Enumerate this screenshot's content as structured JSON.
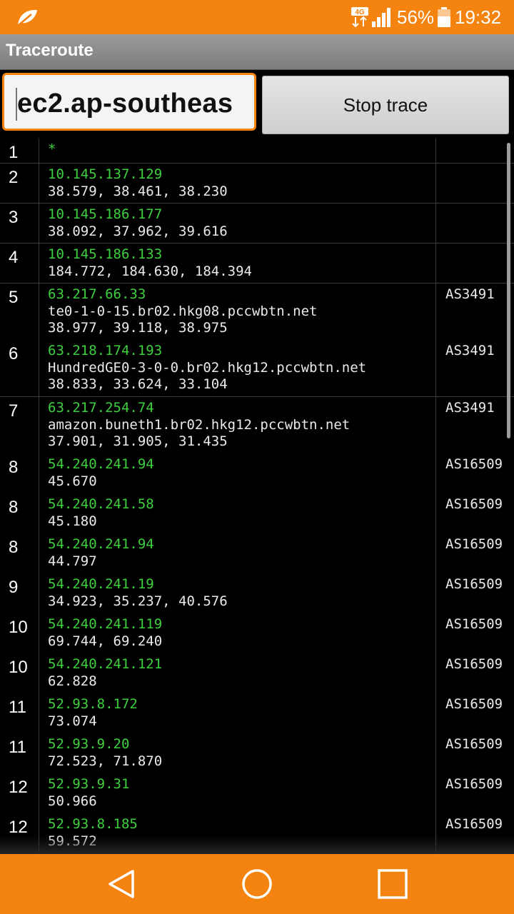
{
  "status_bar": {
    "network_type": "4G",
    "battery_percent": "56%",
    "time": "19:32",
    "icons": [
      "leaf-icon",
      "network-4g-icon",
      "signal-icon",
      "battery-icon"
    ]
  },
  "app": {
    "title": "Traceroute"
  },
  "controls": {
    "host_value": "ec2.ap-southeas",
    "stop_label": "Stop trace"
  },
  "hops": [
    {
      "n": "1",
      "lines": [
        "*"
      ],
      "as": "",
      "h": 34,
      "sep": false
    },
    {
      "n": "2",
      "lines": [
        "10.145.137.129",
        "38.579, 38.461, 38.230"
      ],
      "as": "",
      "h": 56,
      "sep": true
    },
    {
      "n": "3",
      "lines": [
        "10.145.186.177",
        "38.092, 37.962, 39.616"
      ],
      "as": "",
      "h": 56,
      "sep": true
    },
    {
      "n": "4",
      "lines": [
        "10.145.186.133",
        "184.772, 184.630, 184.394"
      ],
      "as": "",
      "h": 56,
      "sep": true
    },
    {
      "n": "5",
      "lines": [
        "63.217.66.33",
        "te0-1-0-15.br02.hkg08.pccwbtn.net",
        "38.977, 39.118, 38.975"
      ],
      "as": "AS3491",
      "h": 80,
      "sep": true
    },
    {
      "n": "6",
      "lines": [
        "63.218.174.193",
        "HundredGE0-3-0-0.br02.hkg12.pccwbtn.net",
        "38.833, 33.624, 33.104"
      ],
      "as": "AS3491",
      "h": 79,
      "sep": false
    },
    {
      "n": "7",
      "lines": [
        "63.217.254.74",
        "amazon.buneth1.br02.hkg12.pccwbtn.net",
        "37.901, 31.905, 31.435"
      ],
      "as": "AS3491",
      "h": 80,
      "sep": true
    },
    {
      "n": "8",
      "lines": [
        "54.240.241.94",
        "45.670"
      ],
      "as": "AS16509",
      "h": 56,
      "sep": false
    },
    {
      "n": "8",
      "lines": [
        "54.240.241.58",
        "45.180"
      ],
      "as": "AS16509",
      "h": 56,
      "sep": false
    },
    {
      "n": "8",
      "lines": [
        "54.240.241.94",
        "44.797"
      ],
      "as": "AS16509",
      "h": 56,
      "sep": false
    },
    {
      "n": "9",
      "lines": [
        "54.240.241.19",
        "34.923, 35.237, 40.576"
      ],
      "as": "AS16509",
      "h": 56,
      "sep": false
    },
    {
      "n": "10",
      "lines": [
        "54.240.241.119",
        "69.744, 69.240"
      ],
      "as": "AS16509",
      "h": 56,
      "sep": false
    },
    {
      "n": "10",
      "lines": [
        "54.240.241.121",
        "62.828"
      ],
      "as": "AS16509",
      "h": 56,
      "sep": false
    },
    {
      "n": "11",
      "lines": [
        "52.93.8.172",
        "73.074"
      ],
      "as": "AS16509",
      "h": 56,
      "sep": false
    },
    {
      "n": "11",
      "lines": [
        "52.93.9.20",
        "72.523, 71.870"
      ],
      "as": "AS16509",
      "h": 56,
      "sep": false
    },
    {
      "n": "12",
      "lines": [
        "52.93.9.31",
        "50.966"
      ],
      "as": "AS16509",
      "h": 56,
      "sep": false
    },
    {
      "n": "12",
      "lines": [
        "52.93.8.185",
        "59.572"
      ],
      "as": "AS16509",
      "h": 56,
      "sep": false
    }
  ],
  "nav_bar": {
    "icons": [
      "back-icon",
      "home-icon",
      "recents-icon"
    ]
  },
  "colors": {
    "accent": "#f5830f",
    "ip_text": "#3ecf3e",
    "body_text": "#eaeaea",
    "background": "#000000"
  }
}
